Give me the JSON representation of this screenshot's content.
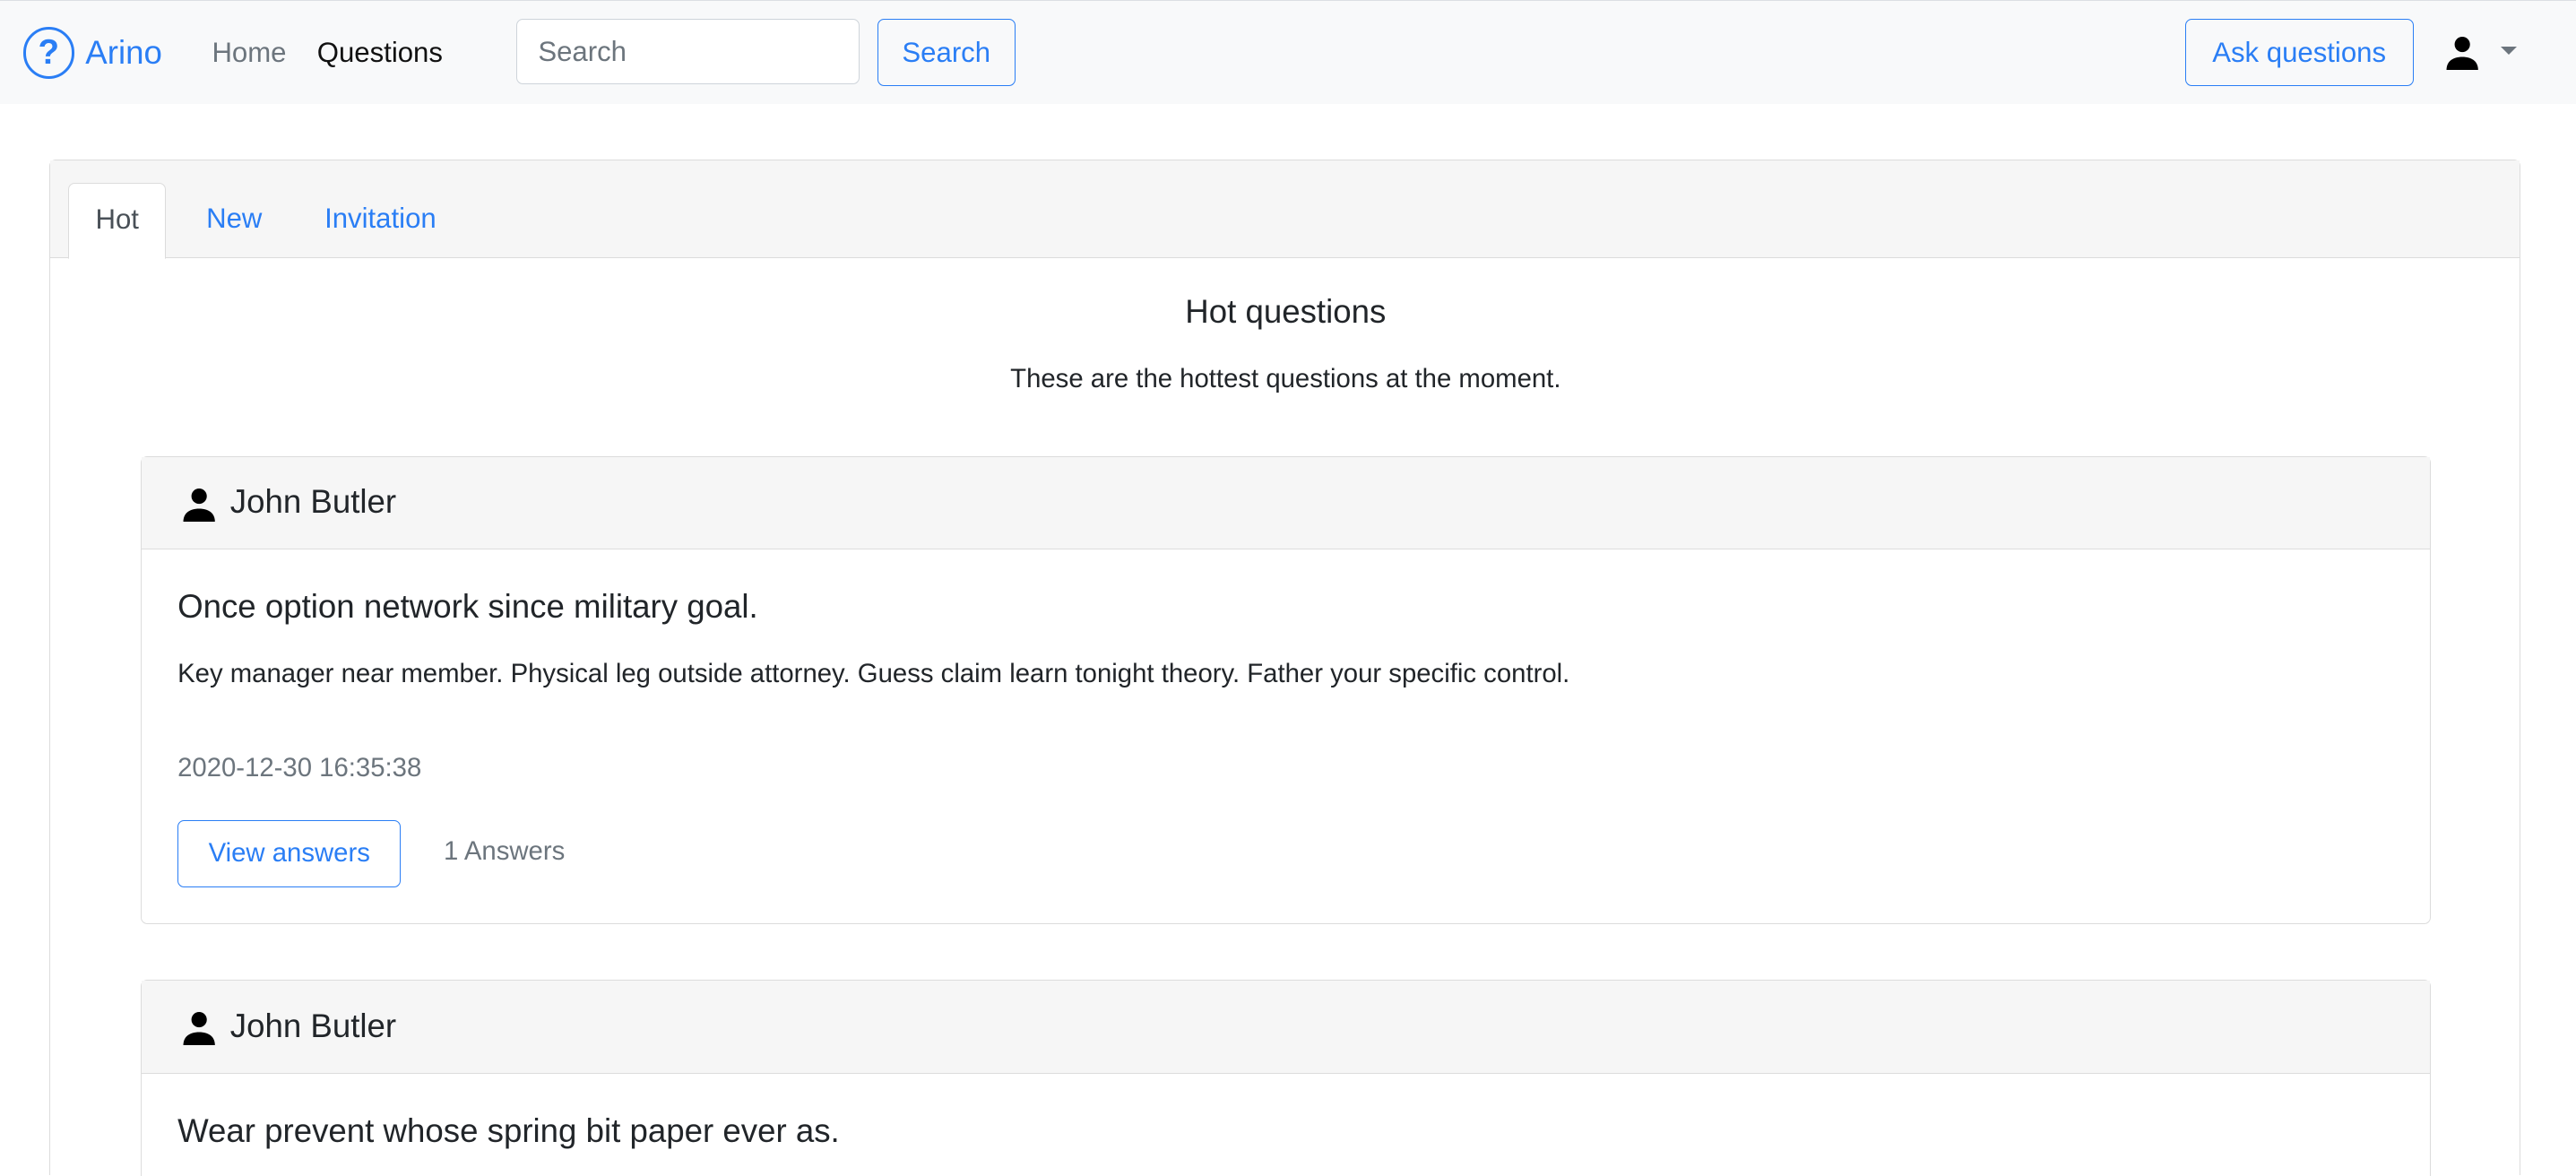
{
  "navbar": {
    "brand": "Arino",
    "links": [
      {
        "label": "Home"
      },
      {
        "label": "Questions"
      }
    ],
    "search_placeholder": "Search",
    "search_button": "Search",
    "ask_button": "Ask questions"
  },
  "tabs": [
    {
      "label": "Hot"
    },
    {
      "label": "New"
    },
    {
      "label": "Invitation"
    }
  ],
  "section": {
    "title": "Hot questions",
    "subtitle": "These are the hottest questions at the moment."
  },
  "questions": [
    {
      "author": "John Butler",
      "title": "Once option network since military goal.",
      "body": "Key manager near member. Physical leg outside attorney. Guess claim learn tonight theory. Father your specific control.",
      "date": "2020-12-30 16:35:38",
      "button": "View answers",
      "answers": "1 Answers"
    },
    {
      "author": "John Butler",
      "title": "Wear prevent whose spring bit paper ever as."
    }
  ]
}
